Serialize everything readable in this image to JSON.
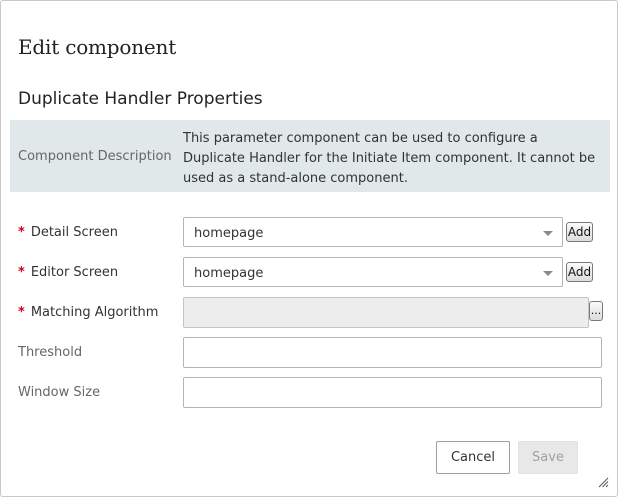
{
  "dialog": {
    "title": "Edit component",
    "section_title": "Duplicate Handler Properties"
  },
  "description": {
    "label": "Component Description",
    "text": "This parameter component can be used to configure a Duplicate Handler for the Initiate Item component. It cannot be used as a stand-alone component."
  },
  "fields": {
    "detail_screen": {
      "label": "Detail Screen",
      "required_mark": "*",
      "value": "homepage",
      "add_label": "Add"
    },
    "editor_screen": {
      "label": "Editor Screen",
      "required_mark": "*",
      "value": "homepage",
      "add_label": "Add"
    },
    "matching_algorithm": {
      "label": "Matching Algorithm",
      "required_mark": "*",
      "value": "",
      "browse_label": "..."
    },
    "threshold": {
      "label": "Threshold",
      "value": ""
    },
    "window_size": {
      "label": "Window Size",
      "value": ""
    }
  },
  "footer": {
    "cancel_label": "Cancel",
    "save_label": "Save"
  },
  "colors": {
    "required": "#d0021b",
    "description_bg": "#e0e8ea",
    "disabled_bg": "#ededed"
  },
  "icons": {
    "dropdown": "chevron-down-icon",
    "resize": "resize-grip-icon"
  }
}
